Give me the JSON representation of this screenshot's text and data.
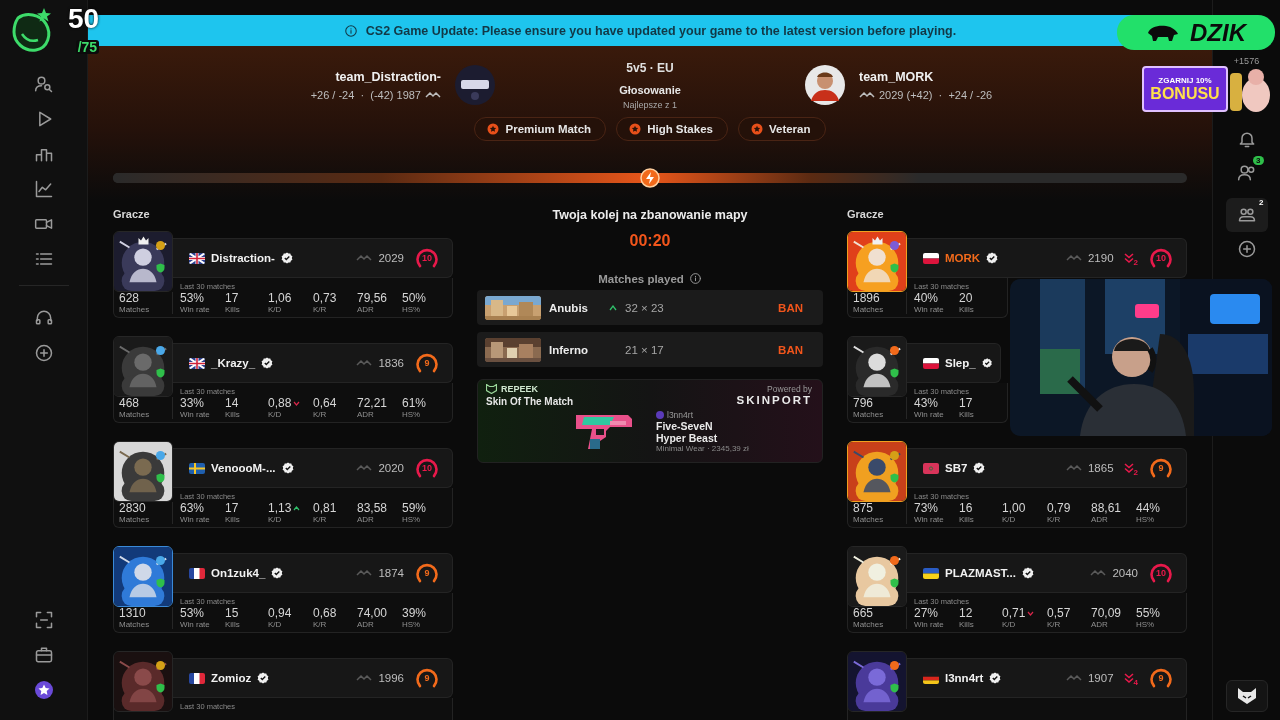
{
  "stream_overlay": {
    "count": "50",
    "total": "/75",
    "sponsor": "DZIK",
    "promo": {
      "line1": "ZGARNIJ 10%",
      "line2": "BONUSU"
    }
  },
  "right_sidebar": {
    "points": "+1576",
    "friends_badge": "3",
    "party_badge": "2"
  },
  "banner": {
    "text": "CS2 Game Update: Please ensure you have updated your game to the latest version before playing."
  },
  "match": {
    "team1": {
      "name": "team_Distraction-",
      "stats": "+26 / -24  ·  (-42) 1987"
    },
    "mode": "5v5 · EU",
    "status": "Głosowanie",
    "format": "Najlepsze z 1",
    "team2": {
      "name": "team_MORK",
      "stats": "2029 (+42)  ·  +24 / -26"
    },
    "tags": [
      "Premium Match",
      "High Stakes",
      "Veteran"
    ],
    "progress": {
      "level": 0.5
    }
  },
  "veto": {
    "title": "Twoja kolej na zbanowanie mapy",
    "timer": "00:20",
    "matches_played": "Matches played",
    "maps": [
      {
        "name": "Anubis",
        "record": "32 × 23",
        "rising": true,
        "action": "BAN"
      },
      {
        "name": "Inferno",
        "record": "21 × 17",
        "rising": false,
        "action": "BAN"
      }
    ]
  },
  "skin_of_match": {
    "brand": "REPEEK",
    "title": "Skin Of The Match",
    "powered_by": "Powered by",
    "partner": "SKINPORT",
    "owner": "l3nn4rt",
    "weapon": "Five-SeveN",
    "skin": "Hyper Beast",
    "details": "Minimal Wear · 2345,39 zł"
  },
  "teams": [
    {
      "heading": "Gracze",
      "players": [
        {
          "name": "Distraction-",
          "elo": "2029",
          "rank": {
            "level": "10",
            "color": "#e8194b"
          },
          "badge": {
            "color": "#d4a017"
          },
          "captain": true,
          "highlighted": false,
          "kd_up": false,
          "kd_down": false,
          "stats_label": "Last 30 matches",
          "stats": [
            {
              "value": "628",
              "label": "Matches"
            },
            {
              "value": "53%",
              "label": "Win rate"
            },
            {
              "value": "17",
              "label": "Kills"
            },
            {
              "value": "1,06",
              "label": "K/D"
            },
            {
              "value": "0,73",
              "label": "K/R"
            },
            {
              "value": "79,56",
              "label": "ADR"
            },
            {
              "value": "50%",
              "label": "HS%"
            }
          ]
        },
        {
          "name": "_Krazy_",
          "elo": "1836",
          "rank": {
            "level": "9",
            "color": "#f26a1b"
          },
          "badge": {
            "color": "#4aa8e8"
          },
          "captain": false,
          "highlighted": false,
          "kd_up": false,
          "kd_down": true,
          "stats_label": "Last 30 matches",
          "stats": [
            {
              "value": "468",
              "label": "Matches"
            },
            {
              "value": "33%",
              "label": "Win rate"
            },
            {
              "value": "14",
              "label": "Kills"
            },
            {
              "value": "0,88",
              "label": "K/D"
            },
            {
              "value": "0,64",
              "label": "K/R"
            },
            {
              "value": "72,21",
              "label": "ADR"
            },
            {
              "value": "61%",
              "label": "HS%"
            }
          ]
        },
        {
          "name": "VenoooM-...",
          "elo": "2020",
          "rank": {
            "level": "10",
            "color": "#e8194b"
          },
          "badge": {
            "color": "#4aa8e8"
          },
          "captain": false,
          "highlighted": false,
          "kd_up": true,
          "kd_down": false,
          "stats_label": "Last 30 matches",
          "stats": [
            {
              "value": "2830",
              "label": "Matches"
            },
            {
              "value": "63%",
              "label": "Win rate"
            },
            {
              "value": "17",
              "label": "Kills"
            },
            {
              "value": "1,13",
              "label": "K/D"
            },
            {
              "value": "0,81",
              "label": "K/R"
            },
            {
              "value": "83,58",
              "label": "ADR"
            },
            {
              "value": "59%",
              "label": "HS%"
            }
          ]
        },
        {
          "name": "On1zuk4_",
          "elo": "1874",
          "rank": {
            "level": "9",
            "color": "#f26a1b"
          },
          "badge": {
            "color": "#4aa8e8"
          },
          "captain": false,
          "highlighted": false,
          "kd_up": false,
          "kd_down": false,
          "stats_label": "Last 30 matches",
          "stats": [
            {
              "value": "1310",
              "label": "Matches"
            },
            {
              "value": "53%",
              "label": "Win rate"
            },
            {
              "value": "15",
              "label": "Kills"
            },
            {
              "value": "0,94",
              "label": "K/D"
            },
            {
              "value": "0,68",
              "label": "K/R"
            },
            {
              "value": "74,00",
              "label": "ADR"
            },
            {
              "value": "39%",
              "label": "HS%"
            }
          ]
        },
        {
          "name": "Zomioz",
          "elo": "1996",
          "rank": {
            "level": "9",
            "color": "#f26a1b"
          },
          "badge": {
            "color": "#d4a017"
          },
          "captain": false,
          "highlighted": false,
          "stats_label": "Last 30 matches"
        }
      ]
    },
    {
      "heading": "Gracze",
      "players": [
        {
          "name": "MORK",
          "elo": "2190",
          "streak": "2",
          "rank": {
            "level": "10",
            "color": "#e8194b"
          },
          "badge": {
            "color": "#7b5cd6"
          },
          "captain": true,
          "highlighted": true,
          "stats_label": "Last 30 matches",
          "stats": [
            {
              "value": "1896",
              "label": "Matches"
            },
            {
              "value": "40%",
              "label": "Win rate"
            },
            {
              "value": "20",
              "label": "Kills"
            }
          ]
        },
        {
          "name": "Slep_",
          "badge": {
            "color": "#f26a1b"
          },
          "captain": false,
          "highlighted": false,
          "stats_label": "Last 30 matches",
          "stats": [
            {
              "value": "796",
              "label": "Matches"
            },
            {
              "value": "43%",
              "label": "Win rate"
            },
            {
              "value": "17",
              "label": "Kills"
            }
          ]
        },
        {
          "name": "SB7",
          "elo": "1865",
          "streak": "2",
          "rank": {
            "level": "9",
            "color": "#f26a1b"
          },
          "badge": {
            "color": "#d4a017"
          },
          "captain": false,
          "highlighted": false,
          "kd_up": false,
          "kd_down": false,
          "stats_label": "Last 30 matches",
          "stats": [
            {
              "value": "875",
              "label": "Matches"
            },
            {
              "value": "73%",
              "label": "Win rate"
            },
            {
              "value": "16",
              "label": "Kills"
            },
            {
              "value": "1,00",
              "label": "K/D"
            },
            {
              "value": "0,79",
              "label": "K/R"
            },
            {
              "value": "88,61",
              "label": "ADR"
            },
            {
              "value": "44%",
              "label": "HS%"
            }
          ]
        },
        {
          "name": "PLAZMAST...",
          "elo": "2040",
          "rank": {
            "level": "10",
            "color": "#e8194b"
          },
          "badge": {
            "color": "#f26a1b"
          },
          "captain": false,
          "highlighted": false,
          "kd_up": false,
          "kd_down": true,
          "stats_label": "Last 30 matches",
          "stats": [
            {
              "value": "665",
              "label": "Matches"
            },
            {
              "value": "27%",
              "label": "Win rate"
            },
            {
              "value": "12",
              "label": "Kills"
            },
            {
              "value": "0,71",
              "label": "K/D"
            },
            {
              "value": "0,57",
              "label": "K/R"
            },
            {
              "value": "70,09",
              "label": "ADR"
            },
            {
              "value": "55%",
              "label": "HS%"
            }
          ]
        },
        {
          "name": "l3nn4rt",
          "elo": "1907",
          "streak": "4",
          "rank": {
            "level": "9",
            "color": "#f26a1b"
          },
          "badge": {
            "color": "#f26a1b"
          },
          "captain": false,
          "highlighted": false
        }
      ]
    }
  ]
}
